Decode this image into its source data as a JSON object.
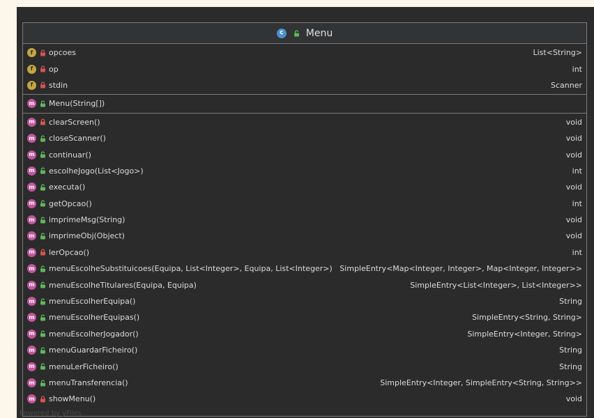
{
  "class": {
    "name": "Menu",
    "kind_icon": "class-c-icon",
    "visibility_icon": "public-lock-icon"
  },
  "fields": [
    {
      "name": "opcoes",
      "type": "List<String>",
      "visibility": "private"
    },
    {
      "name": "op",
      "type": "int",
      "visibility": "private"
    },
    {
      "name": "stdin",
      "type": "Scanner",
      "visibility": "private"
    }
  ],
  "constructors": [
    {
      "name": "Menu(String[])",
      "type": "",
      "visibility": "public"
    }
  ],
  "methods": [
    {
      "name": "clearScreen()",
      "type": "void",
      "visibility": "private"
    },
    {
      "name": "closeScanner()",
      "type": "void",
      "visibility": "public"
    },
    {
      "name": "continuar()",
      "type": "void",
      "visibility": "public"
    },
    {
      "name": "escolheJogo(List<Jogo>)",
      "type": "int",
      "visibility": "public"
    },
    {
      "name": "executa()",
      "type": "void",
      "visibility": "public"
    },
    {
      "name": "getOpcao()",
      "type": "int",
      "visibility": "public"
    },
    {
      "name": "imprimeMsg(String)",
      "type": "void",
      "visibility": "public"
    },
    {
      "name": "imprimeObj(Object)",
      "type": "void",
      "visibility": "public"
    },
    {
      "name": "lerOpcao()",
      "type": "int",
      "visibility": "private"
    },
    {
      "name": "menuEscolheSubstituicoes(Equipa, List<Integer>, Equipa, List<Integer>)",
      "type": "SimpleEntry<Map<Integer, Integer>, Map<Integer, Integer>>",
      "visibility": "public"
    },
    {
      "name": "menuEscolheTitulares(Equipa, Equipa)",
      "type": "SimpleEntry<List<Integer>, List<Integer>>",
      "visibility": "public"
    },
    {
      "name": "menuEscolherEquipa()",
      "type": "String",
      "visibility": "public"
    },
    {
      "name": "menuEscolherEquipas()",
      "type": "SimpleEntry<String, String>",
      "visibility": "public"
    },
    {
      "name": "menuEscolherJogador()",
      "type": "SimpleEntry<Integer, String>",
      "visibility": "public"
    },
    {
      "name": "menuGuardarFicheiro()",
      "type": "String",
      "visibility": "public"
    },
    {
      "name": "menuLerFicheiro()",
      "type": "String",
      "visibility": "public"
    },
    {
      "name": "menuTransferencia()",
      "type": "SimpleEntry<Integer, SimpleEntry<String, String>>",
      "visibility": "public"
    },
    {
      "name": "showMenu()",
      "type": "void",
      "visibility": "private"
    }
  ],
  "watermark": "Powered by yFiles",
  "colors": {
    "field_badge": "#c4a63f",
    "method_badge": "#c2569b",
    "class_badge": "#4a8fcf",
    "private_lock": "#d9534f",
    "public_lock": "#5cb85c"
  },
  "badge_letters": {
    "field": "f",
    "method": "m",
    "class": "c"
  }
}
